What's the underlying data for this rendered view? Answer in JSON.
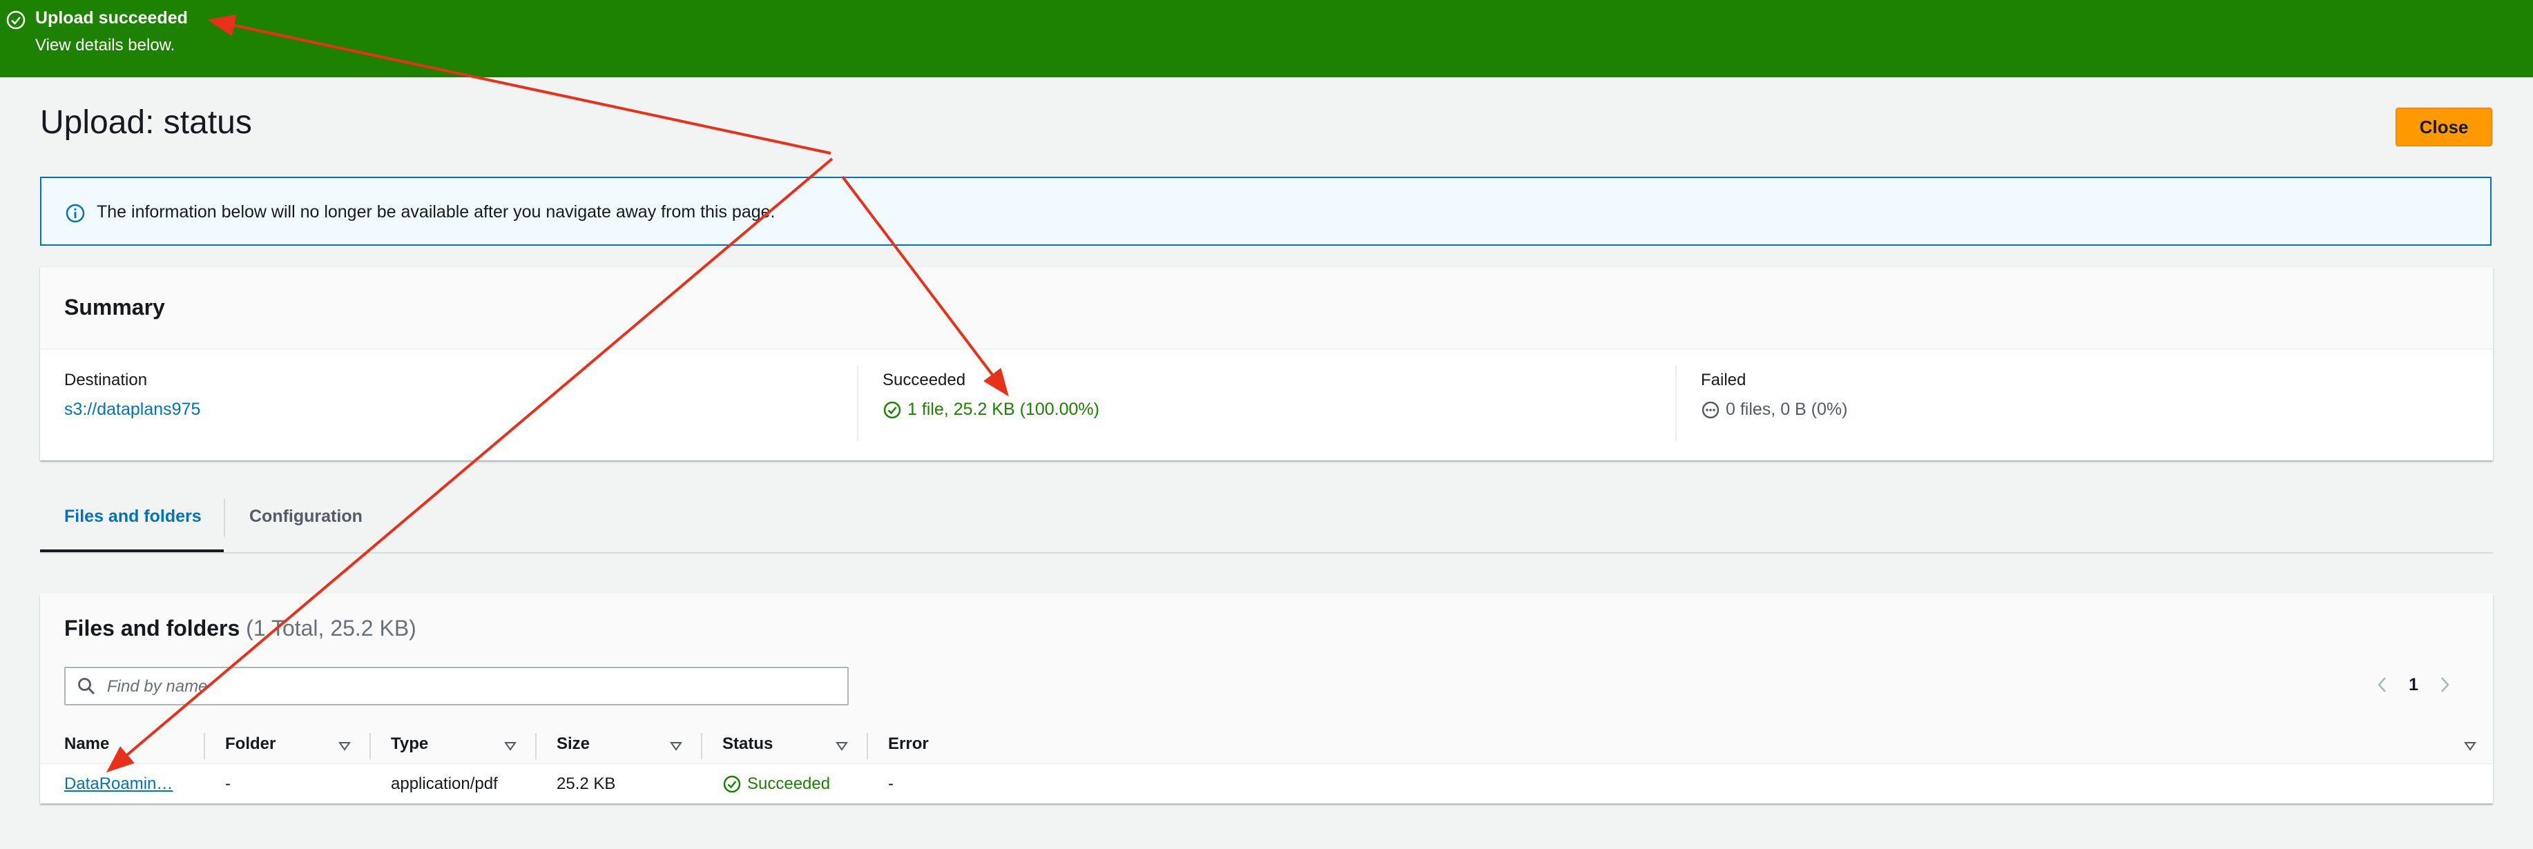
{
  "flash": {
    "title": "Upload succeeded",
    "subtitle": "View details below."
  },
  "page": {
    "title": "Upload: status",
    "close_label": "Close"
  },
  "info": {
    "text": "The information below will no longer be available after you navigate away from this page."
  },
  "summary": {
    "title": "Summary",
    "destination_label": "Destination",
    "destination_value": "s3://dataplans975",
    "succeeded_label": "Succeeded",
    "succeeded_value": "1 file, 25.2 KB (100.00%)",
    "failed_label": "Failed",
    "failed_value": "0 files, 0 B (0%)"
  },
  "tabs": [
    {
      "label": "Files and folders",
      "active": true
    },
    {
      "label": "Configuration",
      "active": false
    }
  ],
  "files": {
    "title": "Files and folders",
    "count": "(1 Total, 25.2 KB)",
    "search_placeholder": "Find by name",
    "page_number": "1",
    "columns": [
      "Name",
      "Folder",
      "Type",
      "Size",
      "Status",
      "Error"
    ],
    "rows": [
      {
        "name": "DataRoamin…",
        "folder": "-",
        "type": "application/pdf",
        "size": "25.2 KB",
        "status": "Succeeded",
        "error": "-"
      }
    ]
  },
  "colors": {
    "success": "#1d8102",
    "link": "#0073bb",
    "primary_button": "#ff9900",
    "annotation_arrow": "#e8311a"
  },
  "icons": [
    "check-circle-icon",
    "info-icon",
    "minus-circle-icon",
    "search-icon",
    "chevron-left-icon",
    "chevron-right-icon",
    "sort-caret-icon"
  ]
}
